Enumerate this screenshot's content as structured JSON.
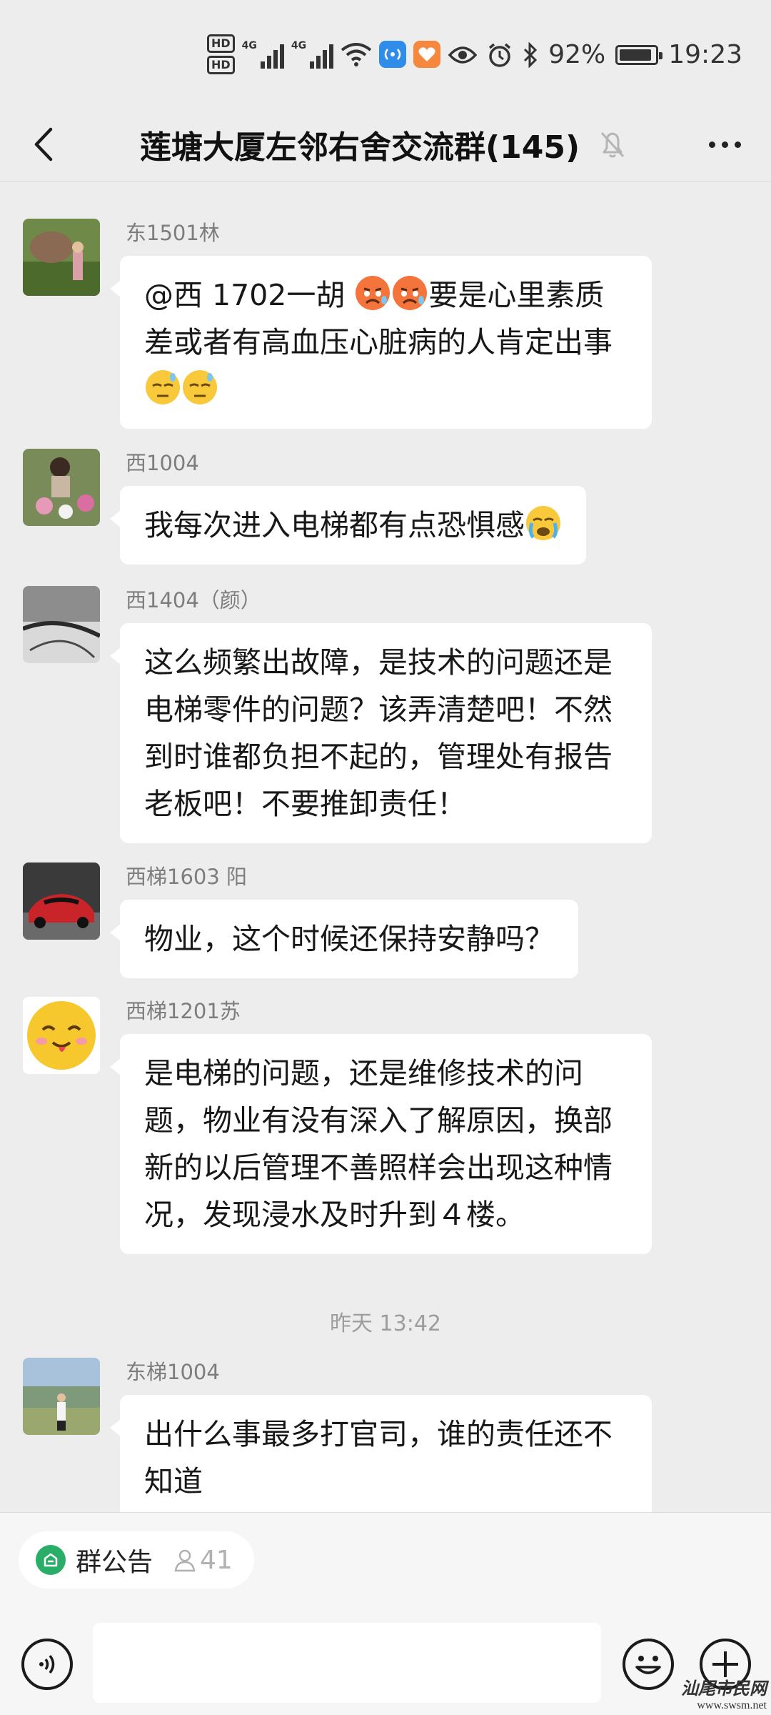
{
  "status_bar": {
    "hd1": "HD",
    "hd2": "HD",
    "net1": "4G",
    "net2": "4G",
    "battery": "92%",
    "time": "19:23"
  },
  "header": {
    "title": "莲塘大厦左邻右舍交流群(145)"
  },
  "messages": [
    {
      "sender": "东1501林",
      "text": "@西 1702一胡 ",
      "text2": "要是心里素质差或者有高血压心脏病的人肯定出事"
    },
    {
      "sender": "西1004",
      "text": "我每次进入电梯都有点恐惧感"
    },
    {
      "sender": "西1404（颜）",
      "text": "这么频繁出故障，是技术的问题还是电梯零件的问题？该弄清楚吧！不然到时谁都负担不起的，管理处有报告老板吧！不要推卸责任！"
    },
    {
      "sender": "西梯1603 阳",
      "text": "物业，这个时候还保持安静吗？"
    },
    {
      "sender": "西梯1201苏",
      "text": "是电梯的问题，还是维修技术的问题，物业有没有深入了解原因，换部新的以后管理不善照样会出现这种情况，发现浸水及时升到４楼。"
    },
    {
      "sender": "东梯1004",
      "text": "出什么事最多打官司，谁的责任还不知道"
    }
  ],
  "timestamp": "昨天 13:42",
  "bottom_bar": {
    "notice_label": "群公告",
    "member_count": "41"
  },
  "watermark": {
    "text": "汕尾市民网",
    "url": "www.swsm.net"
  },
  "colors": {
    "background": "#ededed",
    "bubble": "#ffffff",
    "accent_green": "#2aae67"
  }
}
